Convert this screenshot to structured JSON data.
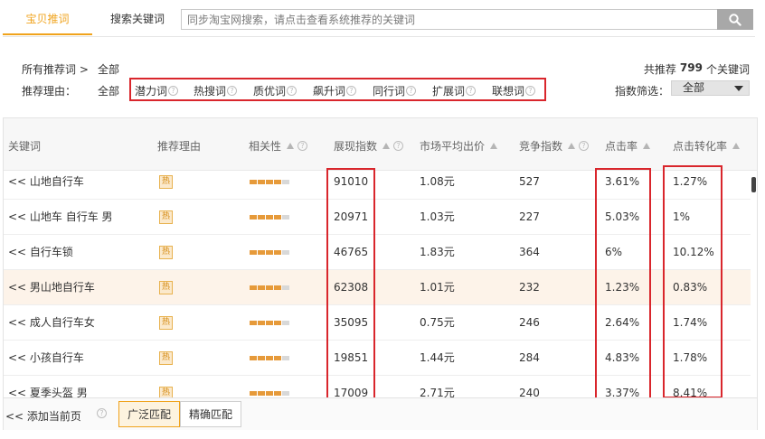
{
  "tabs": {
    "active_label": "宝贝推词",
    "search_label": "搜索关键词"
  },
  "search": {
    "placeholder": "同步淘宝网搜索，请点击查看系统推荐的关键词"
  },
  "filters": {
    "breadcrumb": "所有推荐词 >",
    "breadcrumb_value": "全部",
    "reason_label": "推荐理由：",
    "reason_all": "全部",
    "reasons": [
      "潜力词",
      "热搜词",
      "质优词",
      "飙升词",
      "同行词",
      "扩展词",
      "联想词"
    ],
    "total_prefix": "共推荐",
    "total_count": "799",
    "total_suffix": "个关键词",
    "index_label": "指数筛选：",
    "index_value": "全部"
  },
  "table": {
    "headers": [
      "关键词",
      "推荐理由",
      "相关性",
      "展现指数",
      "市场平均出价",
      "竞争指数",
      "点击率",
      "点击转化率"
    ],
    "hot_badge": "热",
    "rows": [
      {
        "keyword": "<< 山地自行车",
        "relevance": 4,
        "impressions": "91010",
        "avg_bid": "1.08元",
        "competition": "527",
        "ctr": "3.61%",
        "cvr": "1.27%"
      },
      {
        "keyword": "<< 山地车 自行车 男",
        "relevance": 4,
        "impressions": "20971",
        "avg_bid": "1.03元",
        "competition": "227",
        "ctr": "5.03%",
        "cvr": "1%"
      },
      {
        "keyword": "<< 自行车锁",
        "relevance": 4,
        "impressions": "46765",
        "avg_bid": "1.83元",
        "competition": "364",
        "ctr": "6%",
        "cvr": "10.12%"
      },
      {
        "keyword": "<< 男山地自行车",
        "relevance": 4,
        "impressions": "62308",
        "avg_bid": "1.01元",
        "competition": "232",
        "ctr": "1.23%",
        "cvr": "0.83%"
      },
      {
        "keyword": "<< 成人自行车女",
        "relevance": 4,
        "impressions": "35095",
        "avg_bid": "0.75元",
        "competition": "246",
        "ctr": "2.64%",
        "cvr": "1.74%"
      },
      {
        "keyword": "<< 小孩自行车",
        "relevance": 4,
        "impressions": "19851",
        "avg_bid": "1.44元",
        "competition": "284",
        "ctr": "4.83%",
        "cvr": "1.78%"
      },
      {
        "keyword": "<< 夏季头盔 男",
        "relevance": 4,
        "impressions": "17009",
        "avg_bid": "2.71元",
        "competition": "240",
        "ctr": "3.37%",
        "cvr": "8.41%"
      }
    ],
    "highlighted_row": 3
  },
  "bottom": {
    "add_page": "<< 添加当前页",
    "broad_match": "广泛匹配",
    "exact_match": "精确匹配"
  },
  "colors": {
    "accent": "#f0a31c",
    "annotation_red": "#d9262c",
    "highlight_row": "#fdf3e9"
  }
}
